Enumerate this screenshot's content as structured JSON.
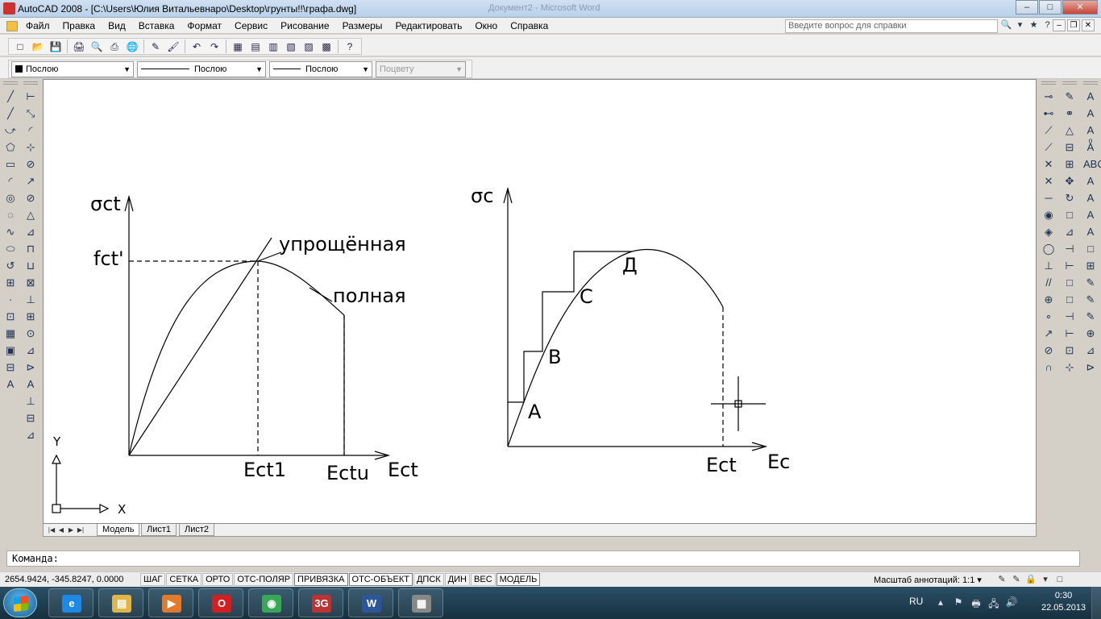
{
  "window": {
    "title": "AutoCAD 2008 - [C:\\Users\\Юлия Витальевнаро\\Desktop\\грунты!!\\графа.dwg]",
    "background_title": "Документ2 - Microsoft Word",
    "buttons": {
      "minimize": "–",
      "maximize": "□",
      "close": "✕"
    }
  },
  "menubar": {
    "items": [
      "Файл",
      "Правка",
      "Вид",
      "Вставка",
      "Формат",
      "Сервис",
      "Рисование",
      "Размеры",
      "Редактировать",
      "Окно",
      "Справка"
    ],
    "help_placeholder": "Введите вопрос для справки",
    "help_icons": [
      "🔍",
      "▾",
      "★",
      "?"
    ],
    "mdi": {
      "minimize": "–",
      "restore": "❐",
      "close": "✕"
    }
  },
  "standard_toolbar": {
    "icons": [
      "new-icon",
      "open-icon",
      "save-icon",
      "print-icon",
      "preview-icon",
      "plot-icon",
      "publish-icon",
      "cut-icon",
      "matchprop-icon",
      "undo-icon",
      "redo-icon",
      "designcenter-icon",
      "properties-icon",
      "toolpalettes-icon",
      "sheetset-icon",
      "markup-icon",
      "calculator-icon",
      "help-icon"
    ],
    "glyphs": [
      "□",
      "📂",
      "💾",
      "🖨",
      "🔍",
      "⎙",
      "🌐",
      "✎",
      "🖌",
      "↶",
      "↷",
      "▦",
      "▤",
      "▥",
      "▧",
      "▨",
      "▩",
      "?"
    ]
  },
  "properties_toolbar": {
    "color": "Послою",
    "linetype": "Послою",
    "lineweight": "Послою",
    "plotstyle": "Поцвету"
  },
  "draw_toolbar": [
    "╱",
    "╱",
    "⤻",
    "⬠",
    "▭",
    "◜",
    "◎",
    "◌",
    "∿",
    "⬭",
    "↺",
    "⊞",
    "·",
    "⊡",
    "▦",
    "▣",
    "⊟",
    "A"
  ],
  "dim_toolbar": [
    "⊢",
    "⤡",
    "◜",
    "⊹",
    "⊘",
    "↗",
    "⊘",
    "△",
    "⊿",
    "⊓",
    "⊔",
    "⊠",
    "⊥",
    "⊞",
    "⊙",
    "⊿",
    "⊳",
    "A",
    "⊥",
    "⊟",
    "⊿"
  ],
  "right_toolbar1": [
    "⊸",
    "⊷",
    "⟋",
    "⟋",
    "✕",
    "✕",
    "─",
    "◉",
    "◈",
    "◯",
    "⊥",
    "//",
    "⊕",
    "∘",
    "↗",
    "⊘",
    "∩"
  ],
  "right_toolbar2": [
    "✎",
    "⚭",
    "△",
    "⊟",
    "⊞",
    "✥",
    "↻",
    "□",
    "⊿",
    "⊣",
    "⊢",
    "□",
    "□",
    "⊣",
    "⊢",
    "⊡",
    "⊹"
  ],
  "right_toolbar3": [
    "A",
    "A",
    "A",
    "Aͦ",
    "ABC",
    "A",
    "A",
    "A",
    "A",
    "□",
    "⊞",
    "✎",
    "✎",
    "✎",
    "⊕",
    "⊿",
    "⊳"
  ],
  "drawing": {
    "left": {
      "y_label": "σct",
      "f_label": "fct'",
      "simplified": "упрощённая",
      "full": "полная",
      "x1": "Ect1",
      "xu": "Ectu",
      "x_axis": "Ect"
    },
    "right": {
      "y_label": "σc",
      "points": [
        "A",
        "B",
        "C",
        "Д"
      ],
      "x1": "Ect",
      "x_axis": "Ec"
    },
    "ucs": {
      "x": "X",
      "y": "Y"
    }
  },
  "layout_tabs": {
    "nav": [
      "|◀",
      "◀",
      "▶",
      "▶|"
    ],
    "tabs": [
      "Модель",
      "Лист1",
      "Лист2"
    ],
    "active": 0
  },
  "command_line": "Команда:",
  "status": {
    "coords": "2654.9424, -345.8247, 0.0000",
    "buttons": [
      "ШАГ",
      "СЕТКА",
      "ОРТО",
      "ОТС-ПОЛЯР",
      "ПРИВЯЗКА",
      "ОТС-ОБЪЕКТ",
      "ДПСК",
      "ДИН",
      "ВЕС",
      "МОДЕЛЬ"
    ],
    "on_buttons": [
      4,
      5,
      9
    ],
    "annotation_scale_label": "Масштаб аннотаций:",
    "annotation_scale": "1:1 ▾",
    "tray_icons": [
      "✎",
      "✎",
      "🔒",
      "▾",
      "□"
    ]
  },
  "taskbar": {
    "apps": [
      {
        "name": "internet-explorer",
        "glyph": "e",
        "color": "#1e88e5"
      },
      {
        "name": "explorer",
        "glyph": "▤",
        "color": "#e0b64a"
      },
      {
        "name": "media",
        "glyph": "▶",
        "color": "#e07b2e"
      },
      {
        "name": "opera",
        "glyph": "O",
        "color": "#d21f1f"
      },
      {
        "name": "chrome",
        "glyph": "◉",
        "color": "#3aa757"
      },
      {
        "name": "3g-modem",
        "glyph": "3G",
        "color": "#b33"
      },
      {
        "name": "word",
        "glyph": "W",
        "color": "#2b579a"
      },
      {
        "name": "autocad",
        "glyph": "▦",
        "color": "#888"
      }
    ],
    "lang": "RU",
    "tray": [
      "▴",
      "⚑",
      "🖶",
      "🖧",
      "🔊"
    ],
    "time": "0:30",
    "date": "22.05.2013"
  }
}
